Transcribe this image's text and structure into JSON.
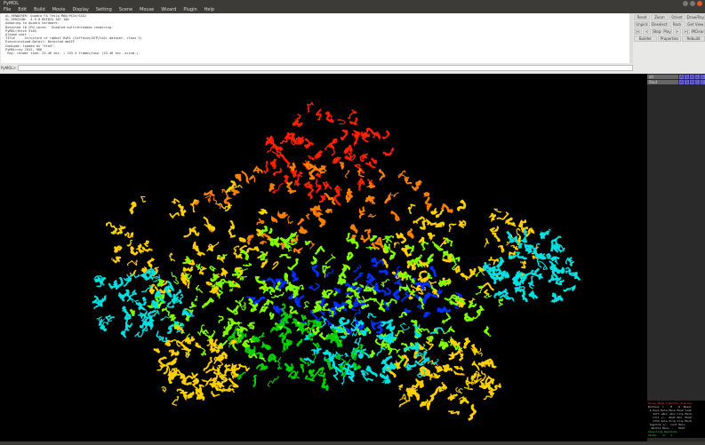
{
  "window": {
    "title": "PyMOL"
  },
  "menu": [
    "File",
    "Edit",
    "Build",
    "Movie",
    "Display",
    "Setting",
    "Scene",
    "Mouse",
    "Wizard",
    "Plugin",
    "Help"
  ],
  "log": [
    " GL_RENDERER: Quadro FX Tesla M60/PCIe/SSE2",
    " GL_VERSION:  4.5.0 NVIDIA 367.106",
    " Adapting to Quadro hardware.",
    " Detected 16 CPU cores.  Enabled multithreaded rendering.",
    "",
    " PyMOL>fetch 5ta3",
    " please wait ...",
    " TITLE     Structure of rabbit RyR1 (Caffeine/ATP/Ca2+ dataset, class 2)",
    " ExecutiveLoad-Detail: Detected mmCIF",
    " CmdLoad: loaded as \"5ta3\".",
    " PyMOL>ray 1912, 966",
    "  Ray: render time: 23.46 sec. = 153.4 frames/hour (23.46 sec. accum.)."
  ],
  "command": {
    "prompt": "PyMOL>",
    "value": ""
  },
  "buttons": {
    "row1": [
      "Reset",
      "Zoom",
      "Orient",
      "Draw/Ray"
    ],
    "row2": [
      "Unpick",
      "Deselect",
      "Rock",
      "Get View"
    ],
    "row3": [
      "|<",
      "<",
      "Stop",
      "Play",
      ">",
      ">|",
      "MClear"
    ],
    "row4": [
      "Builder",
      "Properties",
      "Rebuild"
    ]
  },
  "objects": [
    {
      "name": "all",
      "buttons": [
        "A",
        "S",
        "H",
        "L",
        "C"
      ]
    },
    {
      "name": "5ta3",
      "buttons": [
        "A",
        "S",
        "H",
        "L",
        "C"
      ]
    }
  ],
  "mouse_panel": [
    "Mouse Mode 3-Button Viewing",
    "Buttons  L    M    R  Wheel",
    " & Keys Rota Move MovZ Slab",
    "   Shft +Box -Box Clip MovS",
    "   Ctrl +/-  PkAt Pk1  MvSZ",
    "   CtSh Sele Orig Clip MovZ",
    " SnglClk +/-  Cent Menu",
    "  DblClk Menu  -   PkAt",
    "Selecting Residues",
    "State    1/   1"
  ],
  "colors": {
    "background": "#000000",
    "spectrum": [
      "#ff2000",
      "#ff8000",
      "#ffd000",
      "#80ff00",
      "#00d000",
      "#0030ff",
      "#00e0e0"
    ]
  }
}
